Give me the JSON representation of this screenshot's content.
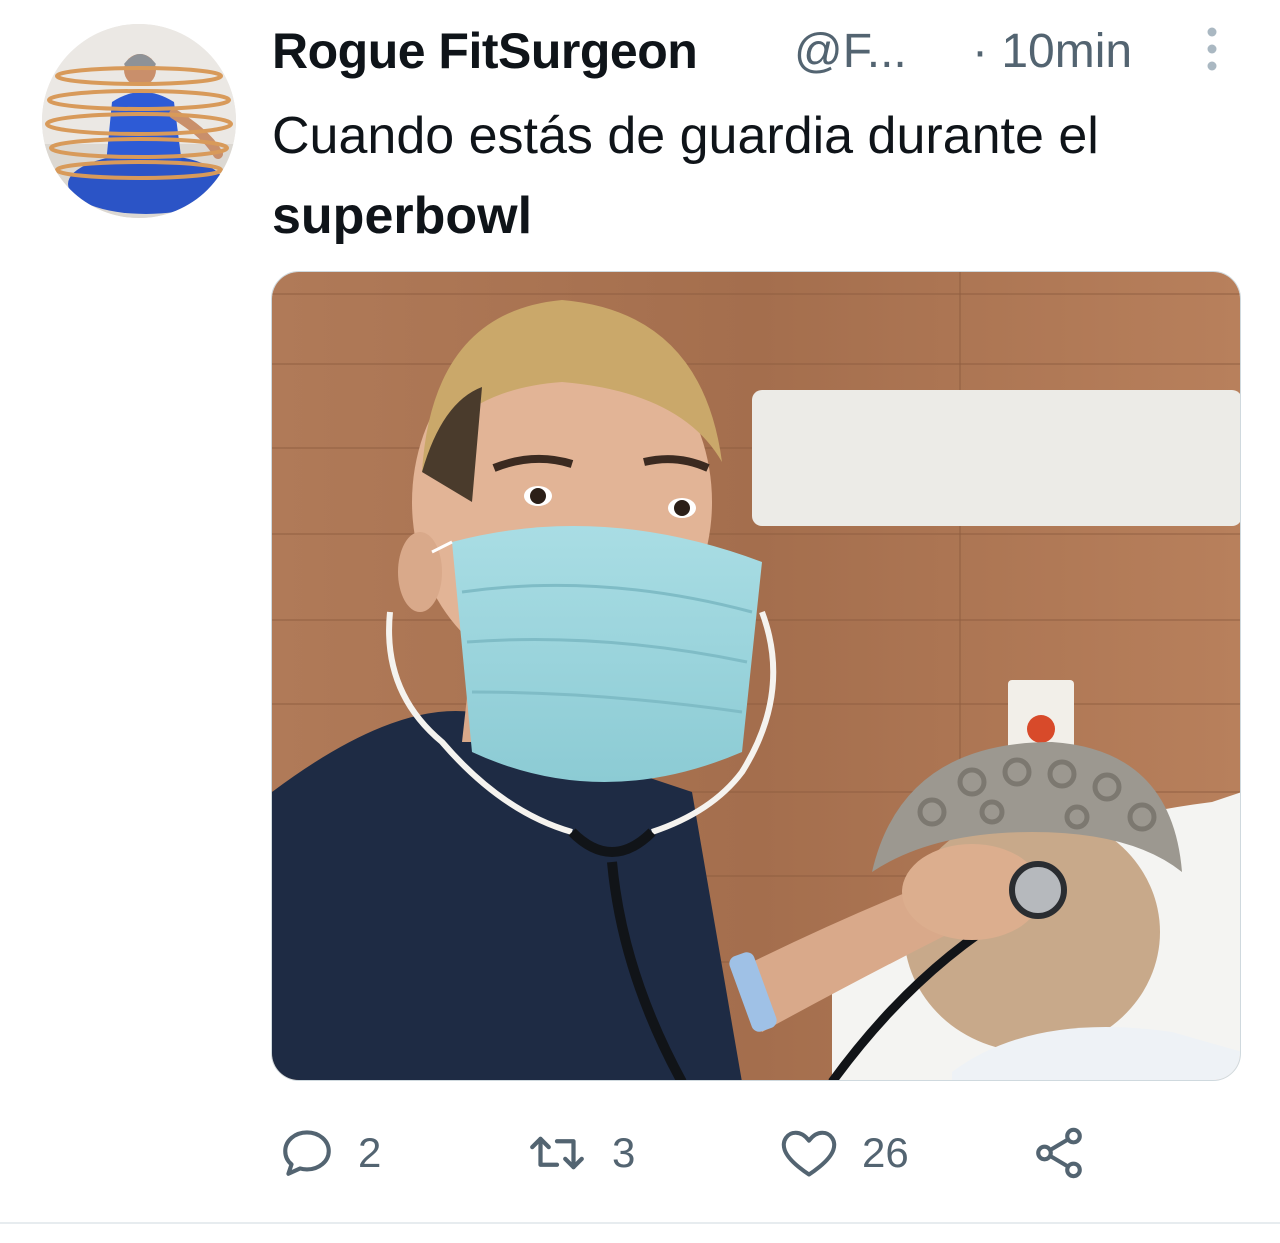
{
  "tweet": {
    "author_name": "Rogue FitSurgeon",
    "author_handle": "@F...",
    "time": "· 10min",
    "text_line1": "Cuando estás de guardia durante el",
    "text_line2": "superbowl",
    "media_image": "selfie-doctor-mask-stethoscope-mannequin",
    "actions": {
      "reply_icon": "reply-icon",
      "reply_count": "2",
      "retweet_icon": "retweet-icon",
      "retweet_count": "3",
      "like_icon": "heart-icon",
      "like_count": "26",
      "share_icon": "share-icon"
    }
  },
  "colors": {
    "text_primary": "#0f1419",
    "text_secondary": "#536471",
    "divider": "#e7ecef"
  }
}
